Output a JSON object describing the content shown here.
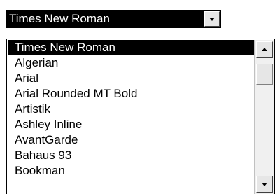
{
  "font_combo": {
    "selected_value": "Times New Roman",
    "dropdown_icon": "chevron-down-icon"
  },
  "font_list": {
    "items": [
      {
        "label": "Times New Roman",
        "selected": true
      },
      {
        "label": "Algerian",
        "selected": false
      },
      {
        "label": "Arial",
        "selected": false
      },
      {
        "label": "Arial Rounded MT Bold",
        "selected": false
      },
      {
        "label": "Artistik",
        "selected": false
      },
      {
        "label": "Ashley Inline",
        "selected": false
      },
      {
        "label": "AvantGarde",
        "selected": false
      },
      {
        "label": "Bahaus 93",
        "selected": false
      },
      {
        "label": "Bookman",
        "selected": false
      }
    ]
  },
  "scrollbar": {
    "up_icon": "arrow-up-icon",
    "down_icon": "arrow-down-icon"
  },
  "colors": {
    "selection_bg": "#000000",
    "selection_fg": "#ffffff",
    "button_face": "#e6e6e6"
  }
}
